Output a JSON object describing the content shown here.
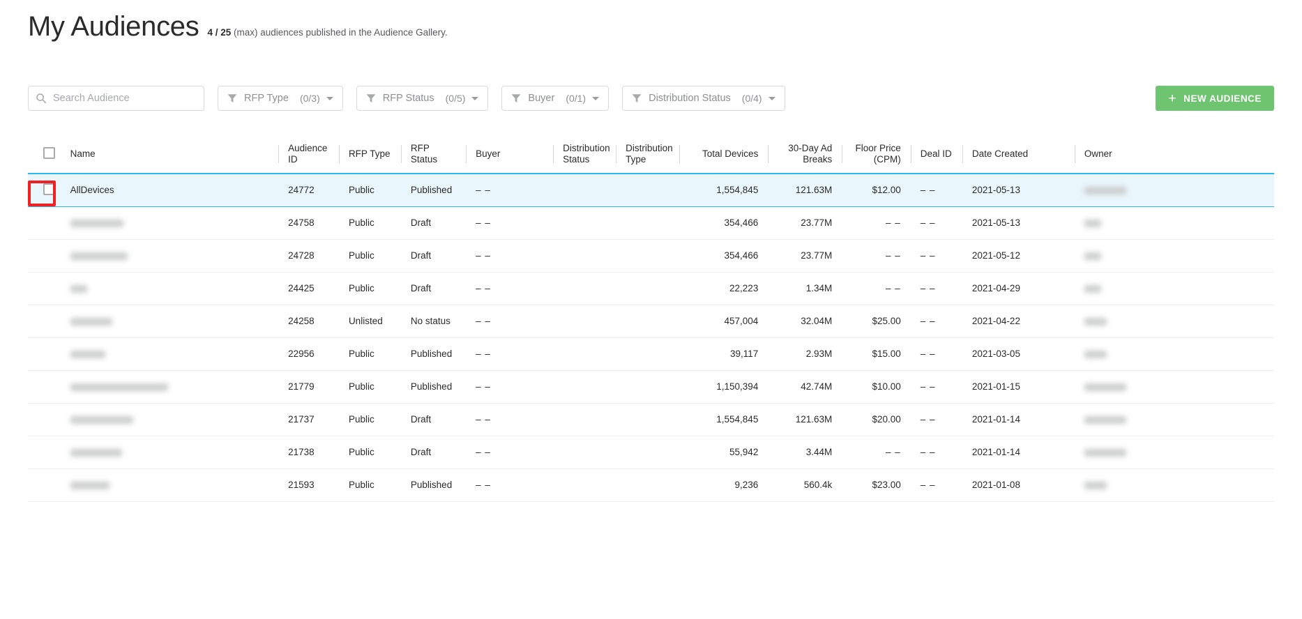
{
  "header": {
    "title": "My Audiences",
    "count": "4 / 25",
    "subtitle_rest": "(max) audiences published in the Audience Gallery."
  },
  "toolbar": {
    "search": {
      "placeholder": "Search Audience",
      "value": "",
      "icon": "search-icon"
    },
    "filters": [
      {
        "label": "RFP Type",
        "count": "(0/3)",
        "icon": "funnel-icon"
      },
      {
        "label": "RFP Status",
        "count": "(0/5)",
        "icon": "funnel-icon"
      },
      {
        "label": "Buyer",
        "count": "(0/1)",
        "icon": "funnel-icon"
      },
      {
        "label": "Distribution Status",
        "count": "(0/4)",
        "icon": "funnel-icon"
      }
    ],
    "new_audience_label": "NEW AUDIENCE",
    "new_audience_plus": "+",
    "settings_icon": "gear-icon"
  },
  "colors": {
    "accent_green": "#6fc46f",
    "selected_row_bg": "#e9f6fc",
    "selected_row_border": "#29b6e8",
    "header_underline": "#29b6e8",
    "annotation_red": "#ee2222"
  },
  "table": {
    "columns": [
      {
        "key": "name",
        "label": "Name",
        "align": "left"
      },
      {
        "key": "audience_id",
        "label": "Audience ID",
        "align": "left"
      },
      {
        "key": "rfp_type",
        "label": "RFP Type",
        "align": "left"
      },
      {
        "key": "rfp_status",
        "label": "RFP Status",
        "align": "left"
      },
      {
        "key": "buyer",
        "label": "Buyer",
        "align": "left"
      },
      {
        "key": "distribution_status",
        "label": "Distribution Status",
        "align": "left"
      },
      {
        "key": "distribution_type",
        "label": "Distribution Type",
        "align": "left"
      },
      {
        "key": "total_devices",
        "label": "Total Devices",
        "align": "right"
      },
      {
        "key": "ad_breaks",
        "label": "30-Day Ad Breaks",
        "align": "right"
      },
      {
        "key": "floor_price",
        "label": "Floor Price (CPM)",
        "align": "right"
      },
      {
        "key": "deal_id",
        "label": "Deal ID",
        "align": "left"
      },
      {
        "key": "date_created",
        "label": "Date Created",
        "align": "left"
      },
      {
        "key": "owner",
        "label": "Owner",
        "align": "left"
      }
    ],
    "rows": [
      {
        "selected": true,
        "name": "AllDevices",
        "name_redacted": false,
        "audience_id": "24772",
        "rfp_type": "Public",
        "rfp_status": "Published",
        "buyer": "– –",
        "distribution_status": "",
        "distribution_type": "",
        "total_devices": "1,554,845",
        "ad_breaks": "121.63M",
        "floor_price": "$12.00",
        "deal_id": "– –",
        "date_created": "2021-05-13",
        "owner": "",
        "owner_redacted": true,
        "owner_width": 60
      },
      {
        "selected": false,
        "name": "",
        "name_redacted": true,
        "name_width": 76,
        "audience_id": "24758",
        "rfp_type": "Public",
        "rfp_status": "Draft",
        "buyer": "– –",
        "distribution_status": "",
        "distribution_type": "",
        "total_devices": "354,466",
        "ad_breaks": "23.77M",
        "floor_price": "– –",
        "deal_id": "– –",
        "date_created": "2021-05-13",
        "owner": "",
        "owner_redacted": true,
        "owner_width": 24
      },
      {
        "selected": false,
        "name": "",
        "name_redacted": true,
        "name_width": 82,
        "audience_id": "24728",
        "rfp_type": "Public",
        "rfp_status": "Draft",
        "buyer": "– –",
        "distribution_status": "",
        "distribution_type": "",
        "total_devices": "354,466",
        "ad_breaks": "23.77M",
        "floor_price": "– –",
        "deal_id": "– –",
        "date_created": "2021-05-12",
        "owner": "",
        "owner_redacted": true,
        "owner_width": 24
      },
      {
        "selected": false,
        "name": "",
        "name_redacted": true,
        "name_width": 24,
        "audience_id": "24425",
        "rfp_type": "Public",
        "rfp_status": "Draft",
        "buyer": "– –",
        "distribution_status": "",
        "distribution_type": "",
        "total_devices": "22,223",
        "ad_breaks": "1.34M",
        "floor_price": "– –",
        "deal_id": "– –",
        "date_created": "2021-04-29",
        "owner": "",
        "owner_redacted": true,
        "owner_width": 24
      },
      {
        "selected": false,
        "name": "",
        "name_redacted": true,
        "name_width": 60,
        "audience_id": "24258",
        "rfp_type": "Unlisted",
        "rfp_status": "No status",
        "buyer": "– –",
        "distribution_status": "",
        "distribution_type": "",
        "total_devices": "457,004",
        "ad_breaks": "32.04M",
        "floor_price": "$25.00",
        "deal_id": "– –",
        "date_created": "2021-04-22",
        "owner": "",
        "owner_redacted": true,
        "owner_width": 32
      },
      {
        "selected": false,
        "name": "",
        "name_redacted": true,
        "name_width": 50,
        "audience_id": "22956",
        "rfp_type": "Public",
        "rfp_status": "Published",
        "buyer": "– –",
        "distribution_status": "",
        "distribution_type": "",
        "total_devices": "39,117",
        "ad_breaks": "2.93M",
        "floor_price": "$15.00",
        "deal_id": "– –",
        "date_created": "2021-03-05",
        "owner": "",
        "owner_redacted": true,
        "owner_width": 32
      },
      {
        "selected": false,
        "name": "",
        "name_redacted": true,
        "name_width": 140,
        "audience_id": "21779",
        "rfp_type": "Public",
        "rfp_status": "Published",
        "buyer": "– –",
        "distribution_status": "",
        "distribution_type": "",
        "total_devices": "1,150,394",
        "ad_breaks": "42.74M",
        "floor_price": "$10.00",
        "deal_id": "– –",
        "date_created": "2021-01-15",
        "owner": "",
        "owner_redacted": true,
        "owner_width": 60
      },
      {
        "selected": false,
        "name": "",
        "name_redacted": true,
        "name_width": 90,
        "audience_id": "21737",
        "rfp_type": "Public",
        "rfp_status": "Draft",
        "buyer": "– –",
        "distribution_status": "",
        "distribution_type": "",
        "total_devices": "1,554,845",
        "ad_breaks": "121.63M",
        "floor_price": "$20.00",
        "deal_id": "– –",
        "date_created": "2021-01-14",
        "owner": "",
        "owner_redacted": true,
        "owner_width": 60
      },
      {
        "selected": false,
        "name": "",
        "name_redacted": true,
        "name_width": 74,
        "audience_id": "21738",
        "rfp_type": "Public",
        "rfp_status": "Draft",
        "buyer": "– –",
        "distribution_status": "",
        "distribution_type": "",
        "total_devices": "55,942",
        "ad_breaks": "3.44M",
        "floor_price": "– –",
        "deal_id": "– –",
        "date_created": "2021-01-14",
        "owner": "",
        "owner_redacted": true,
        "owner_width": 60
      },
      {
        "selected": false,
        "name": "",
        "name_redacted": true,
        "name_width": 56,
        "audience_id": "21593",
        "rfp_type": "Public",
        "rfp_status": "Published",
        "buyer": "– –",
        "distribution_status": "",
        "distribution_type": "",
        "total_devices": "9,236",
        "ad_breaks": "560.4k",
        "floor_price": "$23.00",
        "deal_id": "– –",
        "date_created": "2021-01-08",
        "owner": "",
        "owner_redacted": true,
        "owner_width": 32
      }
    ]
  }
}
